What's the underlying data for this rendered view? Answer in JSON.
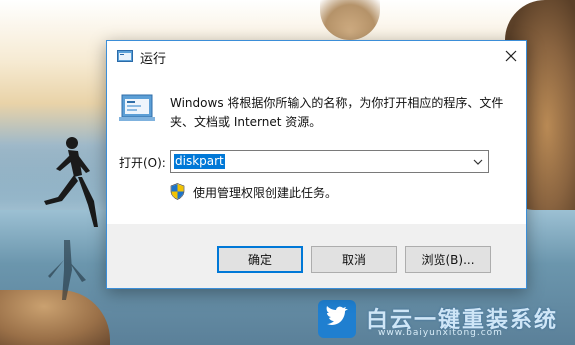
{
  "dialog": {
    "title": "运行",
    "description": "Windows 将根据你所输入的名称，为你打开相应的程序、文件夹、文档或 Internet 资源。",
    "open_label": "打开(O):",
    "open_value": "diskpart",
    "admin_note": "使用管理权限创建此任务。",
    "buttons": {
      "ok": "确定",
      "cancel": "取消",
      "browse": "浏览(B)..."
    }
  },
  "watermark": {
    "name": "白云一键重装系统",
    "url": "www.baiyunxitong.com"
  },
  "colors": {
    "accent": "#0078d7",
    "selection": "#0078d7",
    "dialog_border": "#3b8ed8"
  },
  "icons": [
    "run-window-icon",
    "close-icon",
    "run-program-icon",
    "chevron-down-icon",
    "uac-shield-icon",
    "twitter-bird-icon"
  ]
}
